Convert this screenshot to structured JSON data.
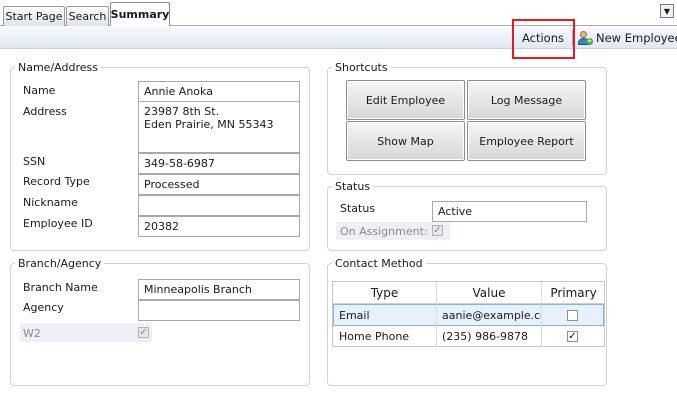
{
  "tabs": [
    {
      "label": "Start Page"
    },
    {
      "label": "Search"
    },
    {
      "label": "Summary"
    }
  ],
  "toolbar": {
    "actions_label": "Actions",
    "new_employee_label": "New Employee"
  },
  "name_address": {
    "legend": "Name/Address",
    "name_label": "Name",
    "name_value": "Annie  Anoka",
    "address_label": "Address",
    "address_value": "23987 8th St.\nEden Prairie, MN 55343",
    "ssn_label": "SSN",
    "ssn_value": "349-58-6987",
    "record_type_label": "Record Type",
    "record_type_value": "Processed",
    "nickname_label": "Nickname",
    "nickname_value": "",
    "employee_id_label": "Employee ID",
    "employee_id_value": "20382"
  },
  "branch_agency": {
    "legend": "Branch/Agency",
    "branch_label": "Branch Name",
    "branch_value": "Minneapolis Branch",
    "agency_label": "Agency",
    "agency_value": "",
    "w2_label": "W2",
    "w2_checked": true
  },
  "shortcuts": {
    "legend": "Shortcuts",
    "edit_employee": "Edit Employee",
    "log_message": "Log Message",
    "show_map": "Show Map",
    "employee_report": "Employee Report"
  },
  "status": {
    "legend": "Status",
    "status_label": "Status",
    "status_value": "Active",
    "on_assignment_label": "On Assignment:",
    "on_assignment_checked": true
  },
  "contact_method": {
    "legend": "Contact Method",
    "columns": [
      "Type",
      "Value",
      "Primary"
    ],
    "rows": [
      {
        "type": "Email",
        "value": "aanie@example.co",
        "primary": false
      },
      {
        "type": "Home Phone",
        "value": "(235) 986-9878",
        "primary": true
      }
    ]
  }
}
